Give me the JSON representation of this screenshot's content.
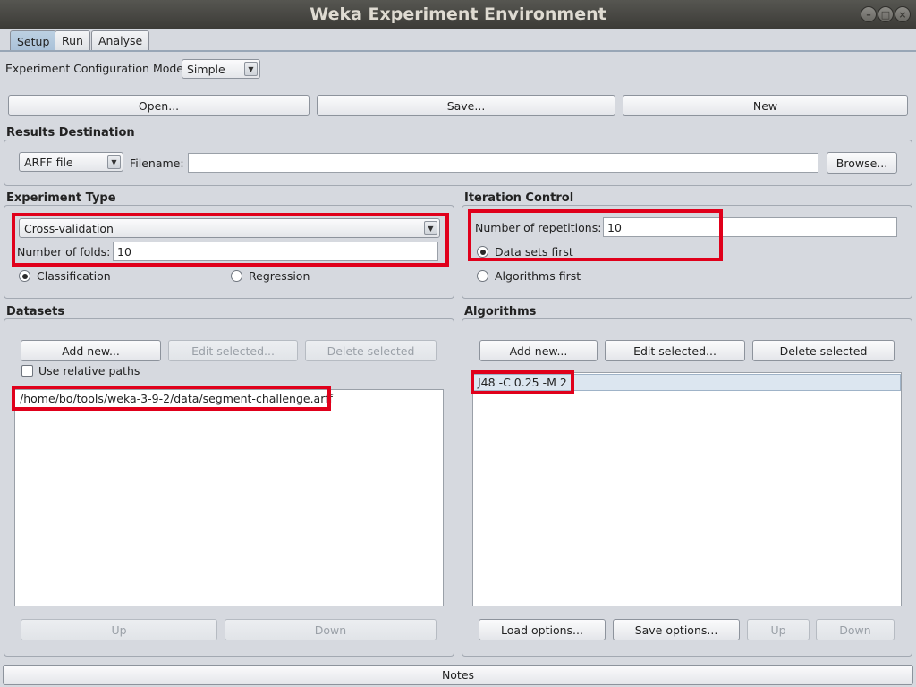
{
  "window": {
    "title": "Weka Experiment Environment"
  },
  "tabs": [
    {
      "label": "Setup",
      "active": true
    },
    {
      "label": "Run",
      "active": false
    },
    {
      "label": "Analyse",
      "active": false
    }
  ],
  "config_mode": {
    "label": "Experiment Configuration Mode",
    "value": "Simple"
  },
  "toolbar": {
    "open": "Open...",
    "save": "Save...",
    "new": "New"
  },
  "results_destination": {
    "title": "Results Destination",
    "format": "ARFF file",
    "filename_label": "Filename:",
    "filename_value": "",
    "browse": "Browse..."
  },
  "experiment_type": {
    "title": "Experiment Type",
    "type_value": "Cross-validation",
    "folds_label": "Number of folds:",
    "folds_value": "10",
    "classification": "Classification",
    "regression": "Regression"
  },
  "iteration_control": {
    "title": "Iteration Control",
    "repetitions_label": "Number of repetitions:",
    "repetitions_value": "10",
    "datasets_first": "Data sets first",
    "algorithms_first": "Algorithms first"
  },
  "datasets": {
    "title": "Datasets",
    "add_new": "Add new...",
    "edit_selected": "Edit selected...",
    "delete_selected": "Delete selected",
    "use_relative_paths": "Use relative paths",
    "items": [
      "/home/bo/tools/weka-3-9-2/data/segment-challenge.arff"
    ],
    "up": "Up",
    "down": "Down"
  },
  "algorithms": {
    "title": "Algorithms",
    "add_new": "Add new...",
    "edit_selected": "Edit selected...",
    "delete_selected": "Delete selected",
    "items": [
      "J48 -C 0.25 -M 2"
    ],
    "load_options": "Load options...",
    "save_options": "Save options...",
    "up": "Up",
    "down": "Down"
  },
  "notes": "Notes",
  "colors": {
    "highlight": "#e0001b",
    "titlebar": "#3c3b37",
    "tab_active": "#a9c1d8"
  }
}
